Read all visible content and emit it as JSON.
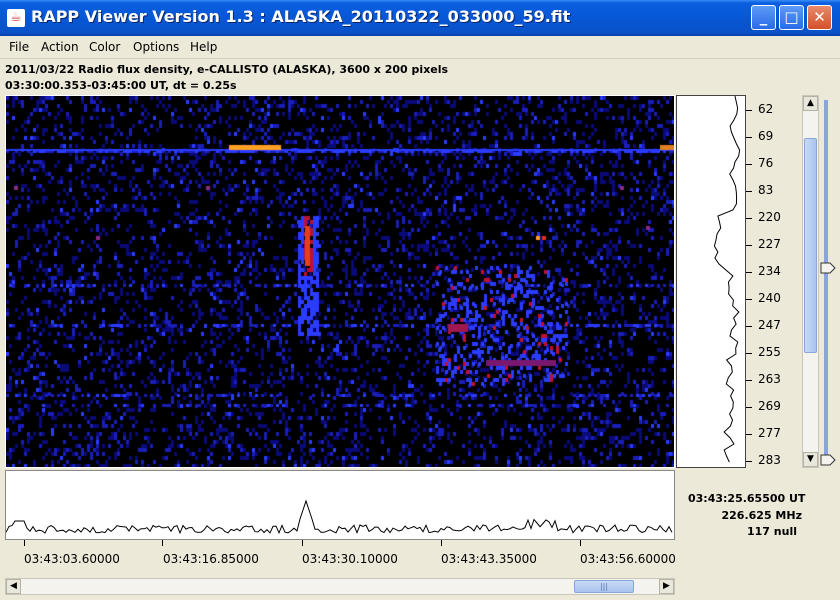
{
  "window": {
    "title": "RAPP Viewer Version 1.3 : ALASKA_20110322_033000_59.fit",
    "minimize_glyph": "_",
    "maximize_glyph": "□",
    "close_glyph": "✕"
  },
  "menu": [
    "File",
    "Action",
    "Color",
    "Options",
    "Help"
  ],
  "info": {
    "line1": "2011/03/22  Radio flux density, e-CALLISTO (ALASKA),  3600 x 200 pixels",
    "line2": "03:30:00.353-03:45:00 UT,  dt = 0.25s"
  },
  "freq_labels": [
    "62",
    "69",
    "76",
    "83",
    "220",
    "227",
    "234",
    "240",
    "247",
    "255",
    "263",
    "269",
    "277",
    "283"
  ],
  "time_labels": [
    "03:43:03.60000",
    "03:43:16.85000",
    "03:43:30.10000",
    "03:43:43.35000",
    "03:43:56.60000"
  ],
  "readout": {
    "time": "03:43:25.65500 UT",
    "freq": "226.625 MHz",
    "value": "117 null"
  },
  "colors": {
    "background": "#000000",
    "low": "#0a0a78",
    "mid": "#2a3cff",
    "high": "#c01030",
    "peak": "#ffa020"
  },
  "icons": {
    "app": "java-cup-icon",
    "scroll_up": "▲",
    "scroll_down": "▼",
    "scroll_left": "◀",
    "scroll_right": "▶",
    "grip": "|||"
  }
}
